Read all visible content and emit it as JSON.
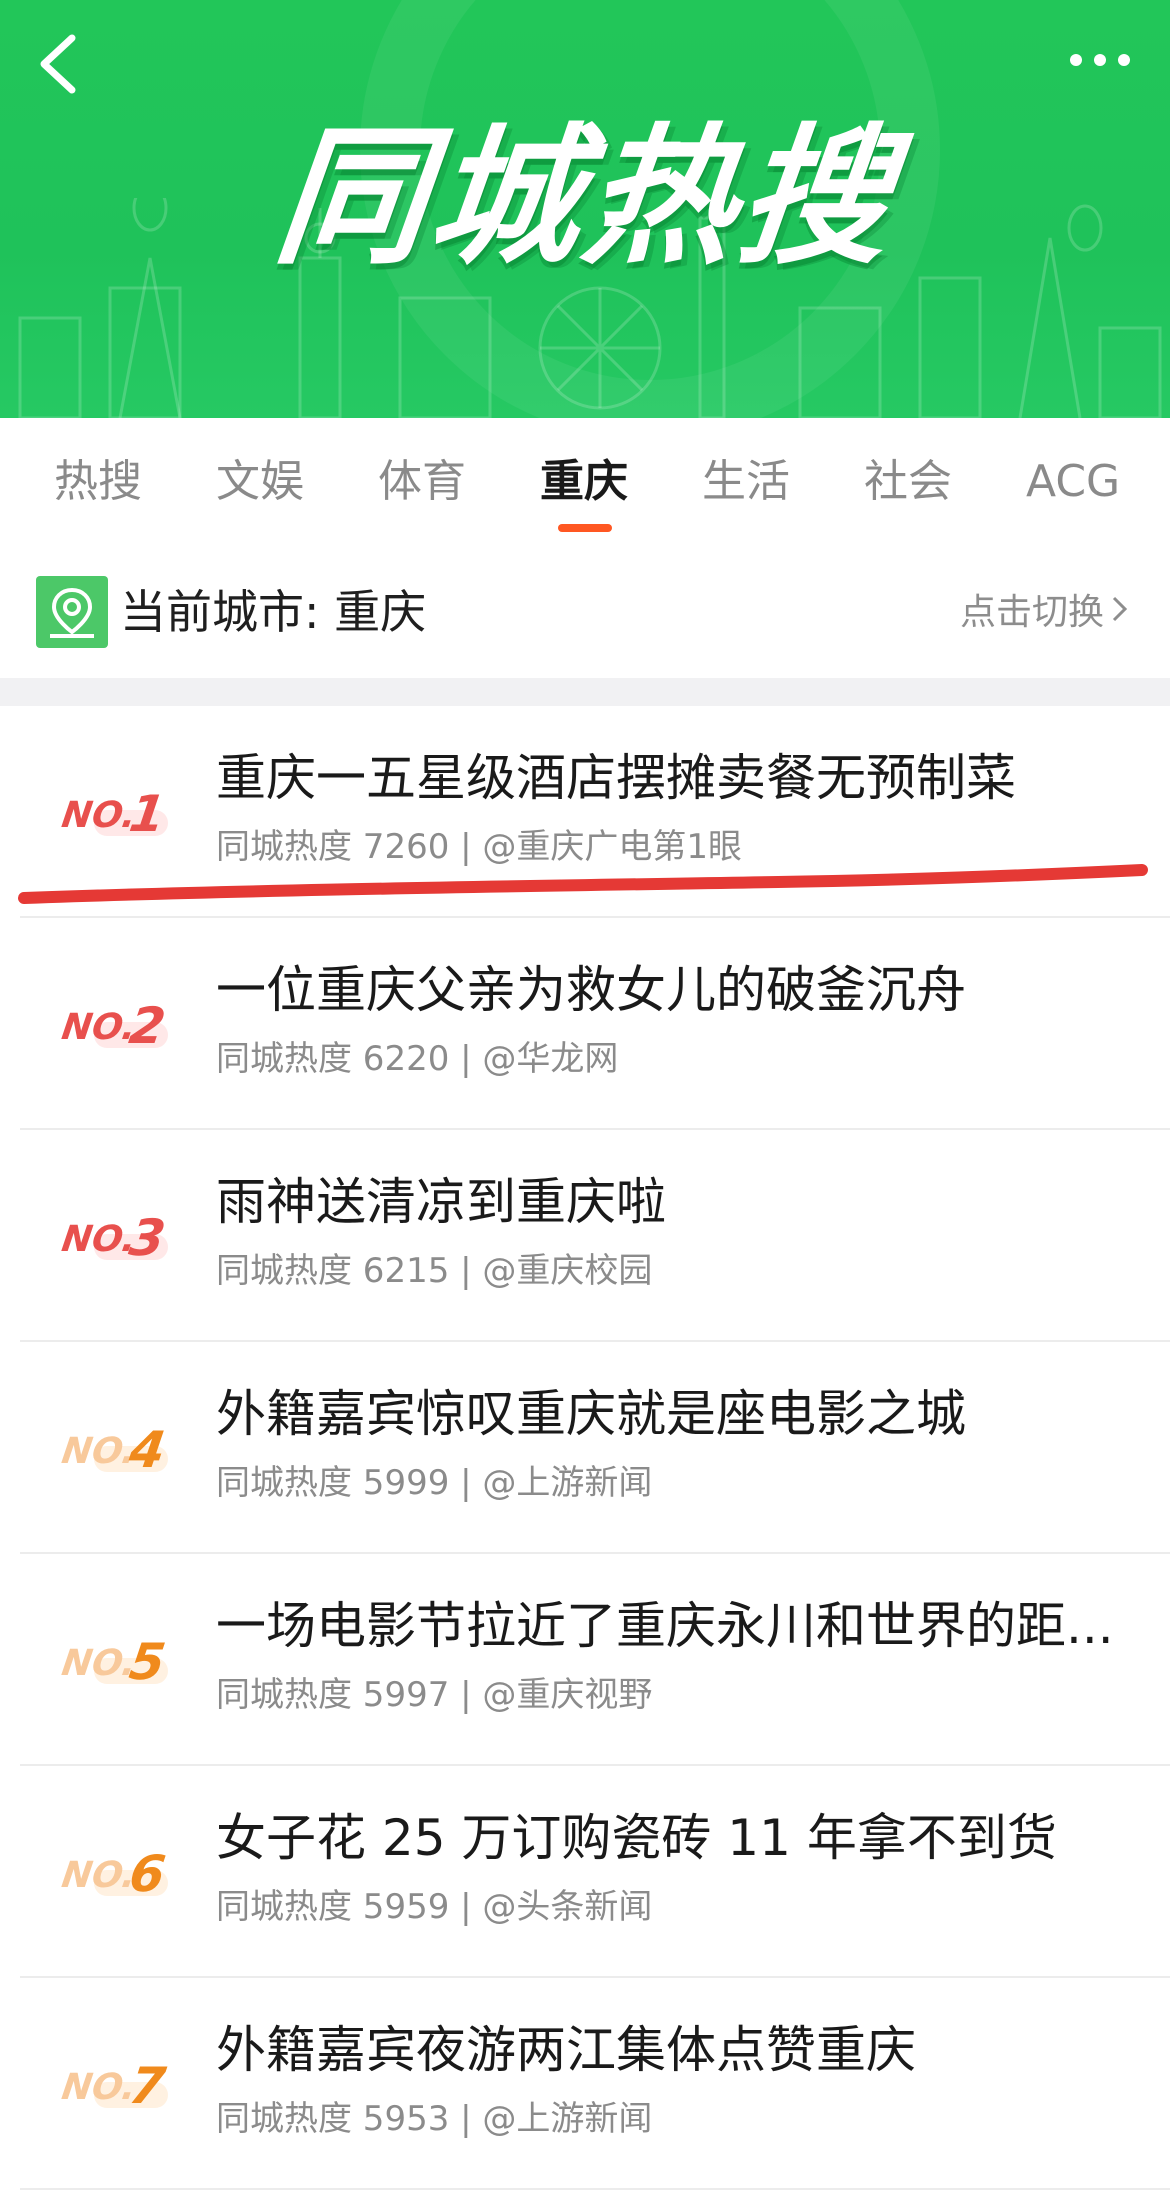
{
  "header": {
    "title": "同城热搜"
  },
  "tabs": [
    {
      "label": "热搜",
      "active": false
    },
    {
      "label": "文娱",
      "active": false
    },
    {
      "label": "体育",
      "active": false
    },
    {
      "label": "重庆",
      "active": true
    },
    {
      "label": "生活",
      "active": false
    },
    {
      "label": "社会",
      "active": false
    },
    {
      "label": "ACG",
      "active": false
    }
  ],
  "city": {
    "label": "当前城市: 重庆",
    "switch_label": "点击切换"
  },
  "list": [
    {
      "rank_no": "NO.",
      "rank": "1",
      "title": "重庆一五星级酒店摆摊卖餐无预制菜",
      "meta": "同城热度 7260 | @重庆广电第1眼"
    },
    {
      "rank_no": "NO.",
      "rank": "2",
      "title": "一位重庆父亲为救女儿的破釜沉舟",
      "meta": "同城热度 6220 | @华龙网"
    },
    {
      "rank_no": "NO.",
      "rank": "3",
      "title": "雨神送清凉到重庆啦",
      "meta": "同城热度 6215 | @重庆校园"
    },
    {
      "rank_no": "NO.",
      "rank": "4",
      "title": "外籍嘉宾惊叹重庆就是座电影之城",
      "meta": "同城热度 5999 | @上游新闻"
    },
    {
      "rank_no": "NO.",
      "rank": "5",
      "title": "一场电影节拉近了重庆永川和世界的距...",
      "meta": "同城热度 5997 | @重庆视野"
    },
    {
      "rank_no": "NO.",
      "rank": "6",
      "title": "女子花 25 万订购瓷砖 11 年拿不到货",
      "meta": "同城热度 5959 | @头条新闻"
    },
    {
      "rank_no": "NO.",
      "rank": "7",
      "title": "外籍嘉宾夜游两江集体点赞重庆",
      "meta": "同城热度 5953 | @上游新闻"
    }
  ],
  "colors": {
    "brand_green": "#22c659",
    "tab_indicator": "#ff5722",
    "rank_red": "#e8504d",
    "rank_orange": "#f08a1c",
    "annotation_red": "#e53935"
  }
}
